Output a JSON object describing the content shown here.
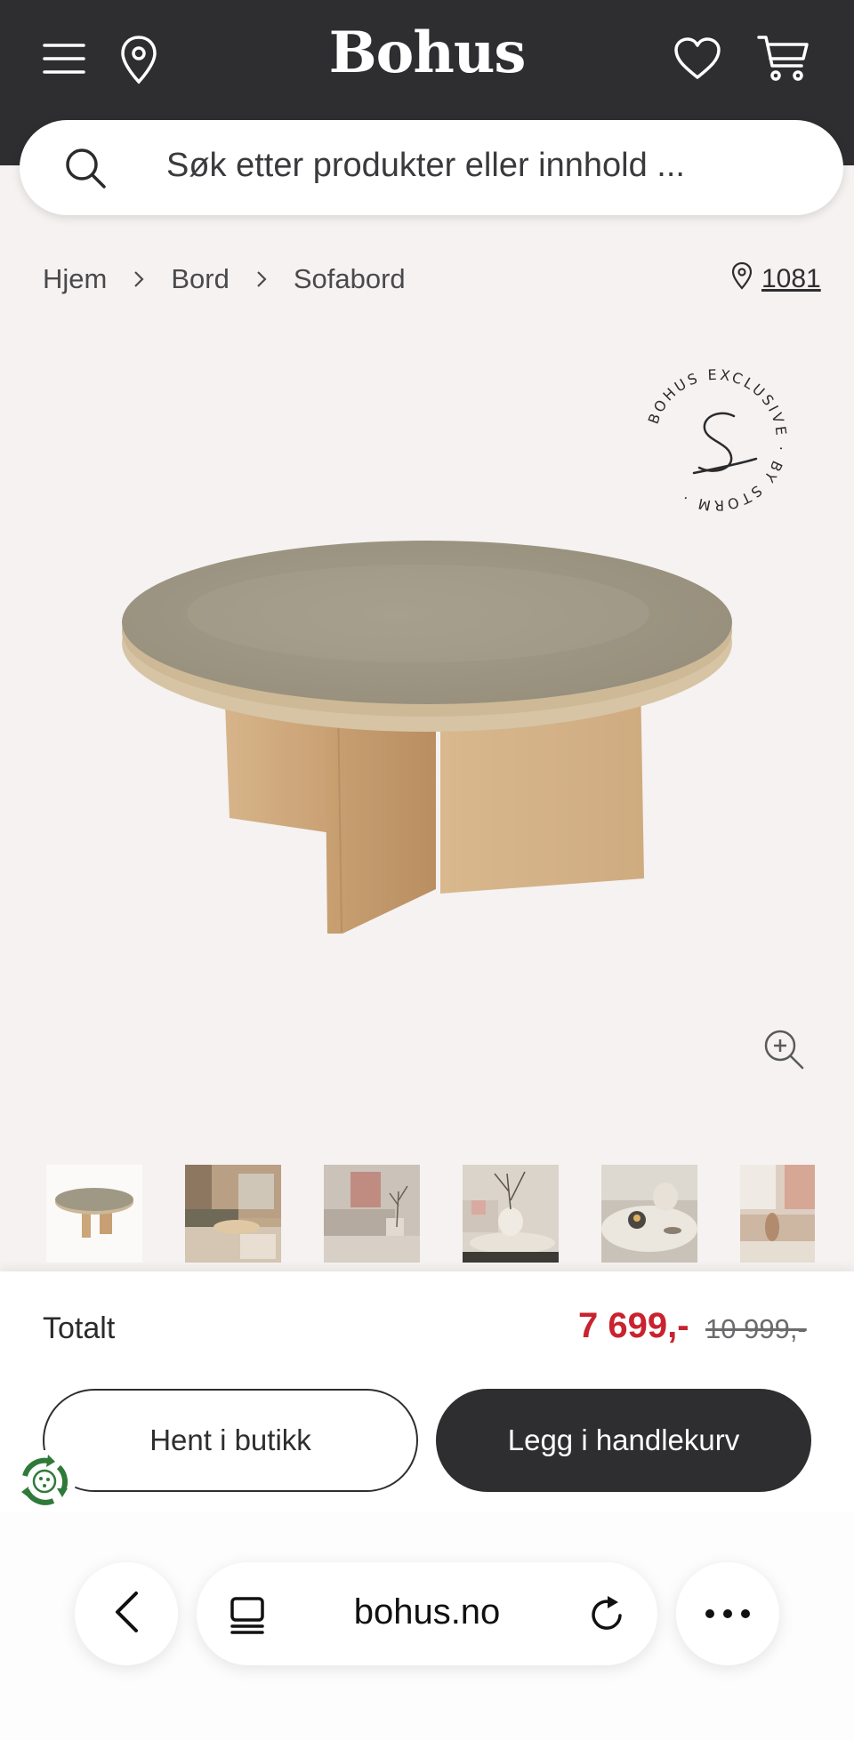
{
  "header": {
    "brand": "Bohus",
    "menu_icon": "hamburger-menu-icon",
    "location_icon": "map-pin-icon",
    "wishlist_icon": "heart-icon",
    "cart_icon": "shopping-cart-icon",
    "background": "#2e2d30"
  },
  "search": {
    "placeholder": "Søk etter produkter eller innhold ..."
  },
  "breadcrumb": {
    "items": [
      "Hjem",
      "Bord",
      "Sofabord"
    ],
    "store_code": "1081"
  },
  "product": {
    "badge_text": "BOHUS EXCLUSIVE · BY STORM ·"
  },
  "purchase": {
    "total_label": "Totalt",
    "price": "7 699,-",
    "old_price": "10 999,-",
    "pickup_button": "Hent i butikk",
    "add_to_cart_button": "Legg i handlekurv",
    "price_color": "#c8232f"
  },
  "browser": {
    "url": "bohus.no"
  }
}
